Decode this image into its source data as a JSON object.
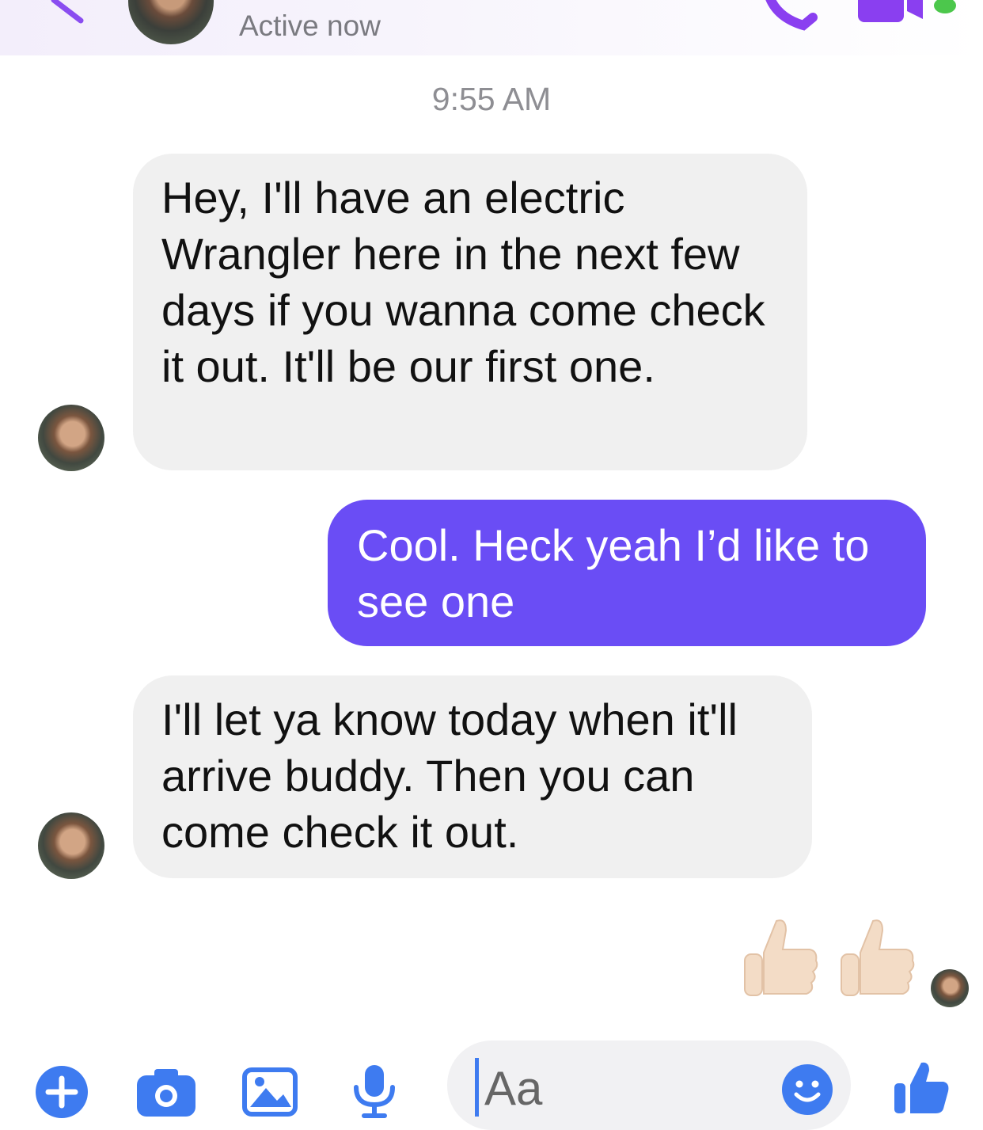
{
  "header": {
    "status": "Active now",
    "accent_color": "#7b3ff2",
    "online_color": "#4cc74c"
  },
  "conversation": {
    "timestamp": "9:55 AM",
    "messages": [
      {
        "direction": "incoming",
        "text": "Hey, I'll have an electric Wrangler here in the next few days if you wanna come check it out. It'll be our first one."
      },
      {
        "direction": "outgoing",
        "text": "Cool. Heck yeah I’d like to see one"
      },
      {
        "direction": "incoming",
        "text": "I'll let ya know today when it'll arrive buddy. Then you can come check it out."
      }
    ],
    "reaction": "👍🏻👍🏻",
    "outgoing_bubble_color": "#6a4df5",
    "incoming_bubble_color": "#f0f0f0"
  },
  "composer": {
    "placeholder": "Aa",
    "icons": [
      "plus-icon",
      "camera-icon",
      "gallery-icon",
      "microphone-icon",
      "emoji-icon",
      "thumbs-up-icon"
    ],
    "icon_color": "#3e7bf0"
  }
}
